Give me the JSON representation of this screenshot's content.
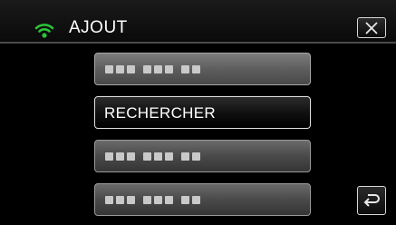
{
  "header": {
    "title": "AJOUT",
    "status_icon": "wifi-icon",
    "close_icon": "close-icon",
    "accent_color": "#29c43a"
  },
  "list": {
    "items": [
      {
        "label": "",
        "placeholder": true
      },
      {
        "label": "RECHERCHER",
        "placeholder": false
      },
      {
        "label": "",
        "placeholder": true
      },
      {
        "label": "",
        "placeholder": true
      }
    ]
  },
  "footer": {
    "back_icon": "return-arrow-icon"
  }
}
